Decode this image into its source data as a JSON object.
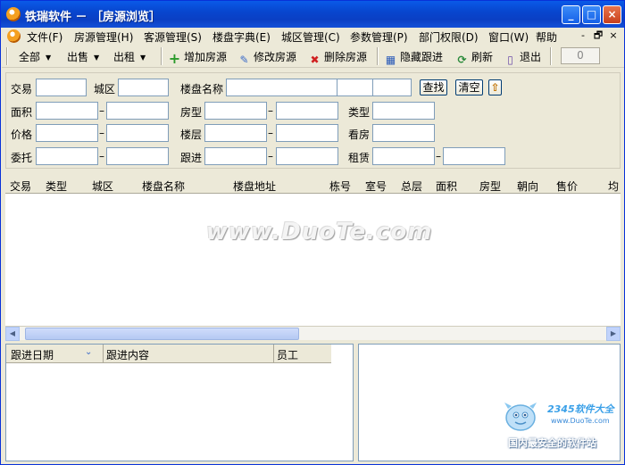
{
  "window": {
    "title": "铁瑞软件 － ［房源浏览］"
  },
  "menubar": {
    "items": [
      "文件(F)",
      "房源管理(H)",
      "客源管理(S)",
      "楼盘字典(E)",
      "城区管理(C)",
      "参数管理(P)",
      "部门权限(D)",
      "窗口(W)",
      "帮助"
    ],
    "mdi_controls": [
      "-",
      "🗗",
      "×"
    ]
  },
  "toolbar": {
    "all_label": "全部",
    "sale_label": "出售",
    "rent_label": "出租",
    "add_label": "增加房源",
    "edit_label": "修改房源",
    "delete_label": "删除房源",
    "hide_label": "隐藏跟进",
    "refresh_label": "刷新",
    "exit_label": "退出",
    "counter_value": "0"
  },
  "filter": {
    "trade": "交易",
    "district": "城区",
    "estate_name": "楼盘名称",
    "search_button": "查找",
    "clear_button": "清空",
    "area": "面积",
    "house_type": "房型",
    "type": "类型",
    "price": "价格",
    "floor": "楼层",
    "viewing": "看房",
    "entrust": "委托",
    "follow_up": "跟进",
    "lease": "租赁",
    "dash": "–"
  },
  "grid": {
    "columns": [
      "交易",
      "类型",
      "城区",
      "楼盘名称",
      "楼盘地址",
      "栋号",
      "室号",
      "总层",
      "面积",
      "房型",
      "朝向",
      "售价",
      "均"
    ]
  },
  "followup": {
    "columns": [
      "跟进日期",
      "跟进内容",
      "员工"
    ]
  },
  "watermark": {
    "text": "www.DuoTe.com",
    "brand": "2345软件大全",
    "site": "www.DuoTe.com",
    "slogan": "国内最安全的软件站"
  },
  "colors": {
    "titlebar": "#0a4bd0",
    "face": "#ece9d8",
    "field_border": "#7f9db9"
  }
}
